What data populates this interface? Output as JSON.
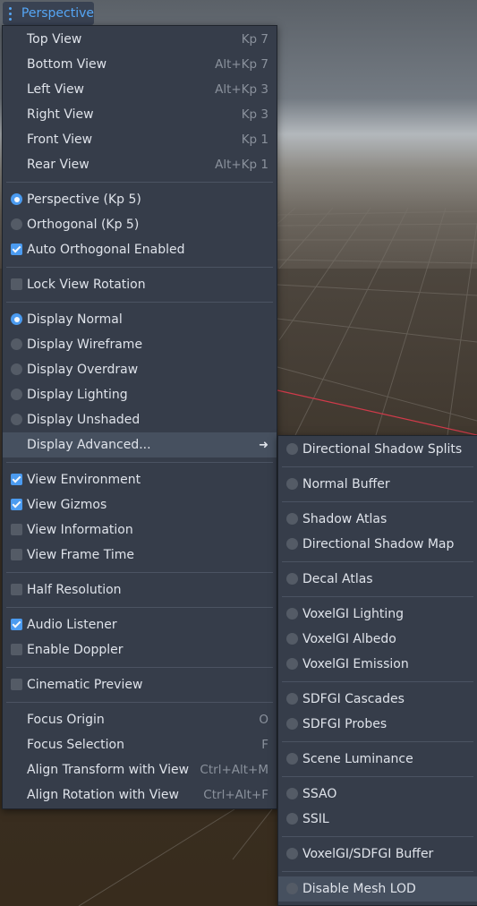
{
  "view_button": {
    "label": "Perspective",
    "icon": "kebab-menu-icon"
  },
  "menu": {
    "views": [
      {
        "label": "Top View",
        "shortcut": "Kp 7"
      },
      {
        "label": "Bottom View",
        "shortcut": "Alt+Kp 7"
      },
      {
        "label": "Left View",
        "shortcut": "Alt+Kp 3"
      },
      {
        "label": "Right View",
        "shortcut": "Kp 3"
      },
      {
        "label": "Front View",
        "shortcut": "Kp 1"
      },
      {
        "label": "Rear View",
        "shortcut": "Alt+Kp 1"
      }
    ],
    "projection": [
      {
        "label": "Perspective (Kp 5)",
        "checked": true
      },
      {
        "label": "Orthogonal (Kp 5)",
        "checked": false
      },
      {
        "label": "Auto Orthogonal Enabled",
        "checked": true
      }
    ],
    "lock": {
      "label": "Lock View Rotation",
      "checked": false
    },
    "display": [
      {
        "label": "Display Normal",
        "checked": true
      },
      {
        "label": "Display Wireframe",
        "checked": false
      },
      {
        "label": "Display Overdraw",
        "checked": false
      },
      {
        "label": "Display Lighting",
        "checked": false
      },
      {
        "label": "Display Unshaded",
        "checked": false
      }
    ],
    "display_advanced": {
      "label": "Display Advanced..."
    },
    "view_toggles": [
      {
        "label": "View Environment",
        "checked": true
      },
      {
        "label": "View Gizmos",
        "checked": true
      },
      {
        "label": "View Information",
        "checked": false
      },
      {
        "label": "View Frame Time",
        "checked": false
      }
    ],
    "half_resolution": {
      "label": "Half Resolution",
      "checked": false
    },
    "audio": [
      {
        "label": "Audio Listener",
        "checked": true
      },
      {
        "label": "Enable Doppler",
        "checked": false
      }
    ],
    "cinematic": {
      "label": "Cinematic Preview",
      "checked": false
    },
    "focus": [
      {
        "label": "Focus Origin",
        "shortcut": "O"
      },
      {
        "label": "Focus Selection",
        "shortcut": "F"
      },
      {
        "label": "Align Transform with View",
        "shortcut": "Ctrl+Alt+M"
      },
      {
        "label": "Align Rotation with View",
        "shortcut": "Ctrl+Alt+F"
      }
    ]
  },
  "submenu": {
    "items": [
      {
        "label": "Directional Shadow Splits"
      },
      {
        "label": "Normal Buffer"
      },
      {
        "label": "Shadow Atlas"
      },
      {
        "label": "Directional Shadow Map"
      },
      {
        "label": "Decal Atlas"
      },
      {
        "label": "VoxelGI Lighting"
      },
      {
        "label": "VoxelGI Albedo"
      },
      {
        "label": "VoxelGI Emission"
      },
      {
        "label": "SDFGI Cascades"
      },
      {
        "label": "SDFGI Probes"
      },
      {
        "label": "Scene Luminance"
      },
      {
        "label": "SSAO"
      },
      {
        "label": "SSIL"
      },
      {
        "label": "VoxelGI/SDFGI Buffer"
      },
      {
        "label": "Disable Mesh LOD"
      }
    ]
  },
  "colors": {
    "accent": "#4b9bf0",
    "menu_bg": "#363d4a",
    "highlight": "#46505f",
    "x_axis": "#d03a4a"
  }
}
